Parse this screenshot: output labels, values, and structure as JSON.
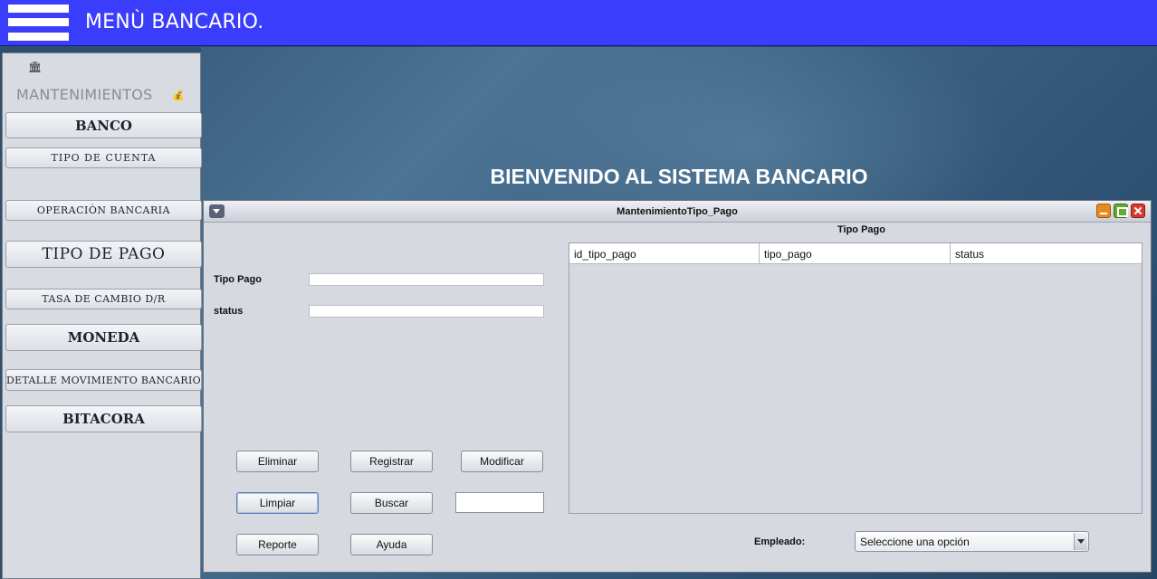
{
  "header": {
    "title": "MENÙ BANCARIO."
  },
  "desktop": {
    "welcome": "BIENVENIDO AL SISTEMA BANCARIO"
  },
  "sidebar": {
    "bank_icon": "🏛",
    "heading": "MANTENIMIENTOS",
    "money_icon": "💰",
    "items": [
      {
        "label": "BANCO"
      },
      {
        "label": "TIPO DE CUENTA"
      },
      {
        "label": "OPERACIÒN BANCARIA"
      },
      {
        "label": "TIPO DE PAGO"
      },
      {
        "label": "TASA DE CAMBIO D/R"
      },
      {
        "label": "MONEDA"
      },
      {
        "label": "DETALLE MOVIMIENTO BANCARIO"
      },
      {
        "label": "BITACORA"
      }
    ]
  },
  "window": {
    "title": "MantenimientoTipo_Pago",
    "form": {
      "tipo_pago_label": "Tipo Pago",
      "tipo_pago_value": "",
      "status_label": "status",
      "status_value": "",
      "search_value": ""
    },
    "buttons": {
      "eliminar": "Eliminar",
      "registrar": "Registrar",
      "modificar": "Modificar",
      "limpiar": "Limpiar",
      "buscar": "Buscar",
      "reporte": "Reporte",
      "ayuda": "Ayuda"
    },
    "table": {
      "caption": "Tipo Pago",
      "columns": [
        "id_tipo_pago",
        "tipo_pago",
        "status"
      ],
      "rows": []
    },
    "empleado": {
      "label": "Empleado:",
      "selected": "Seleccione una opción"
    }
  }
}
